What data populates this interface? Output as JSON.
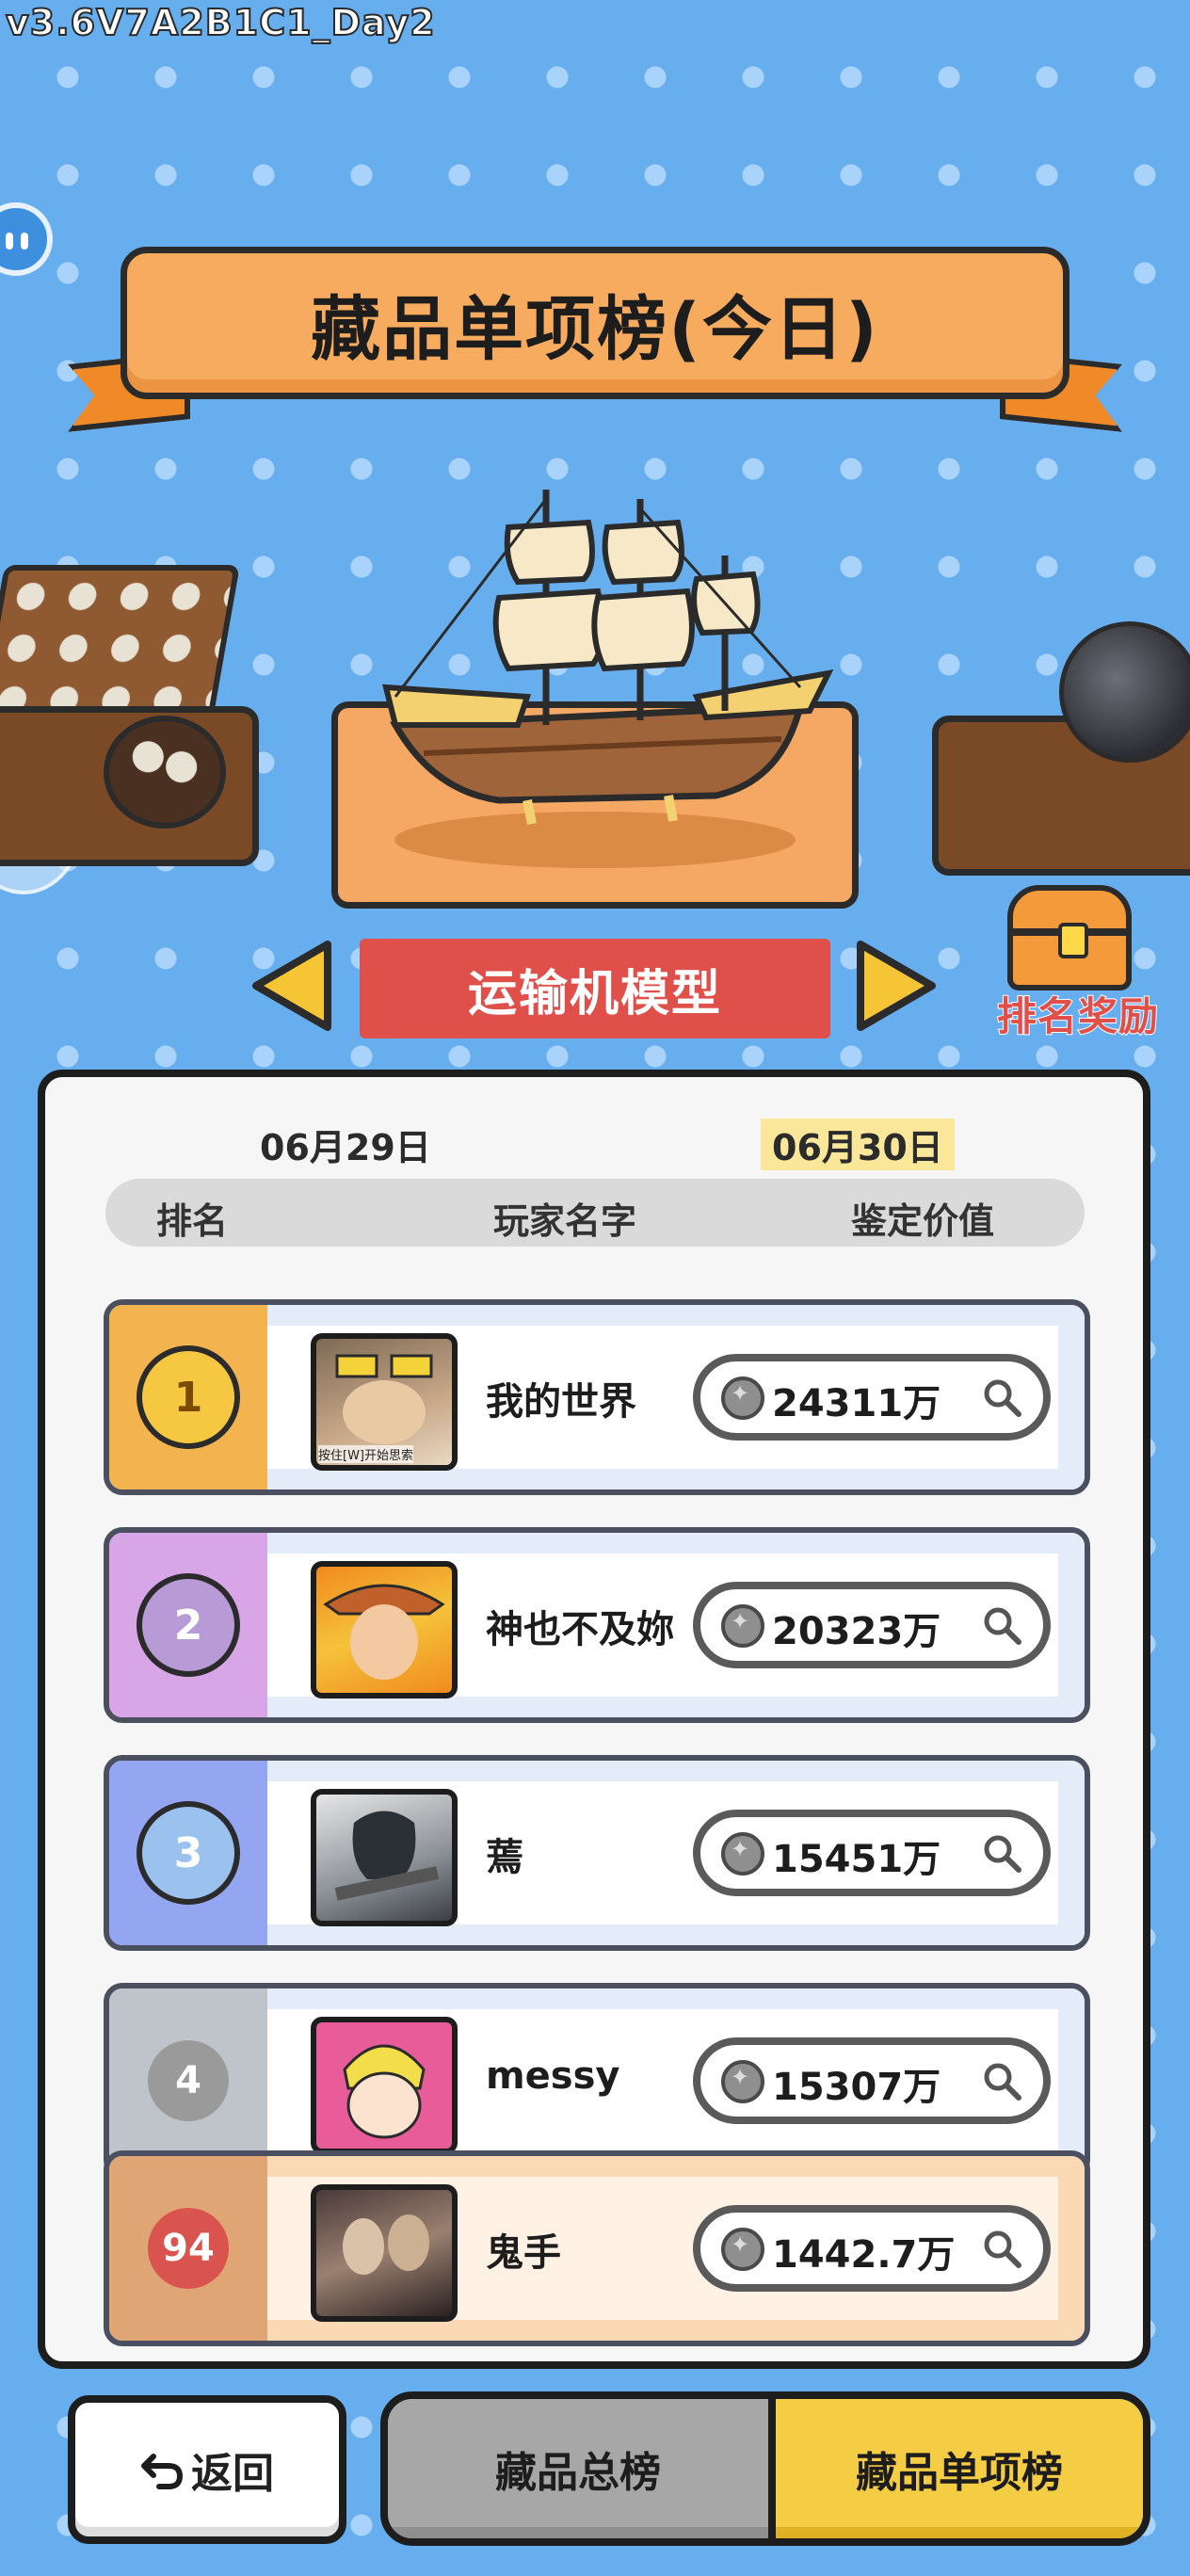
{
  "version_label": "v3.6V7A2B1C1_Day2",
  "title": "藏品单项榜(今日)",
  "selector": {
    "item_name": "运输机模型"
  },
  "reward": {
    "label": "排名奖励"
  },
  "dates": {
    "previous": "06月29日",
    "current": "06月30日"
  },
  "columns": {
    "rank": "排名",
    "player": "玩家名字",
    "value": "鉴定价值"
  },
  "rows": [
    {
      "rank": "1",
      "player": "我的世界",
      "value": "24311万",
      "avatar_caption": "按住[W]开始思索",
      "rank_color": "#f3b450",
      "medal_color": "#f6c842"
    },
    {
      "rank": "2",
      "player": "神也不及妳",
      "value": "20323万",
      "rank_color": "#d8a6e6",
      "medal_color": "#b89ad6"
    },
    {
      "rank": "3",
      "player": "蔫",
      "value": "15451万",
      "rank_color": "#94a6f2",
      "medal_color": "#9bc2ee"
    },
    {
      "rank": "4",
      "player": "messy",
      "value": "15307万",
      "rank_color": "#bfc4ca",
      "medal_color": "#9a9a9a"
    }
  ],
  "my_row": {
    "rank": "94",
    "player": "鬼手",
    "value": "1442.7万",
    "rank_color": "#e0a574",
    "medal_color": "#d9534f"
  },
  "buttons": {
    "back": "返回",
    "tab_total": "藏品总榜",
    "tab_single": "藏品单项榜"
  }
}
